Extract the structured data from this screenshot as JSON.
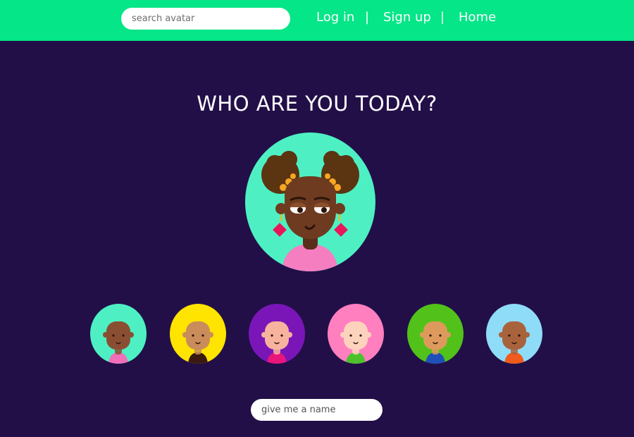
{
  "header": {
    "search_placeholder": "search avatar",
    "nav": [
      {
        "label": "Log in"
      },
      {
        "label": "Sign up"
      },
      {
        "label": "Home"
      }
    ],
    "separator": "|"
  },
  "main": {
    "title": "WHO ARE YOU TODAY?",
    "name_placeholder": "give me a name"
  },
  "colors": {
    "topbar": "#04e687",
    "background": "#220f48",
    "hero_bg": "#4ef0c3"
  },
  "avatars": [
    {
      "bg": "#4ef0c3",
      "skin": "#8a4f33",
      "shirt": "#f06fb8",
      "icon": "avatar-icon"
    },
    {
      "bg": "#ffe400",
      "skin": "#c98c5a",
      "shirt": "#3a1a10",
      "icon": "avatar-icon"
    },
    {
      "bg": "#7a16b8",
      "skin": "#f7b39d",
      "shirt": "#e8157a",
      "icon": "avatar-icon"
    },
    {
      "bg": "#ff7fbf",
      "skin": "#fdd3bd",
      "shirt": "#4cc12b",
      "icon": "avatar-icon"
    },
    {
      "bg": "#52c21a",
      "skin": "#de9a5c",
      "shirt": "#1f4fb8",
      "icon": "avatar-icon"
    },
    {
      "bg": "#8fdcf8",
      "skin": "#a8633c",
      "shirt": "#f05a1a",
      "icon": "avatar-icon"
    }
  ]
}
